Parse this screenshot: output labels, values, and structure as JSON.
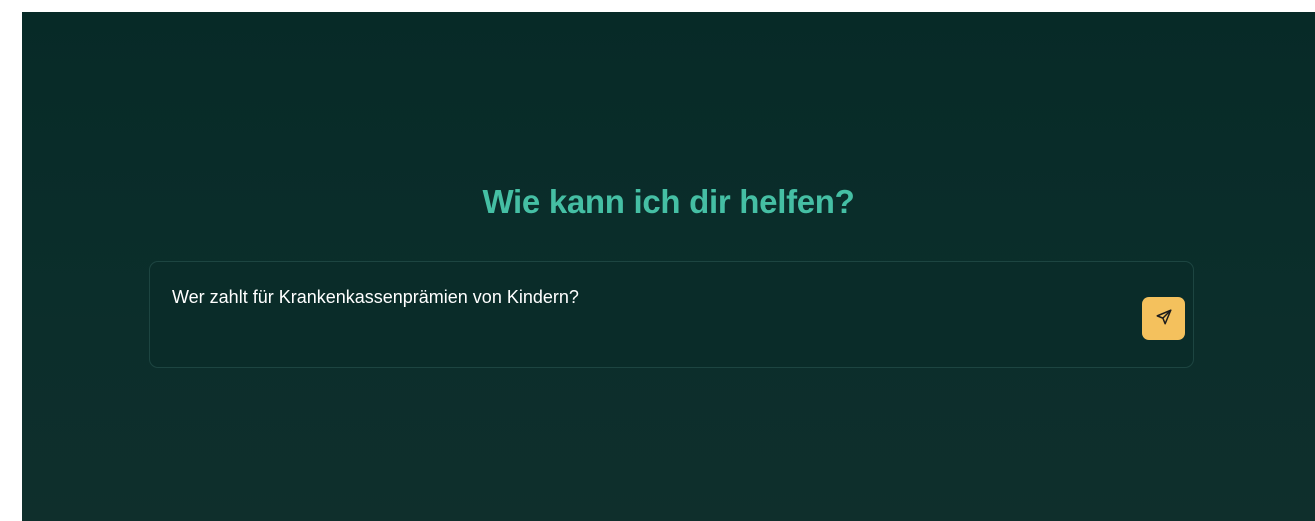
{
  "main": {
    "heading": "Wie kann ich dir helfen?"
  },
  "chat": {
    "input_value": "Wer zahlt für Krankenkassenprämien von Kindern?",
    "send_icon": "send-icon"
  },
  "colors": {
    "background": "#0b2e2b",
    "heading": "#45bfa4",
    "send_button": "#f4c15d",
    "input_text": "#ffffff"
  }
}
